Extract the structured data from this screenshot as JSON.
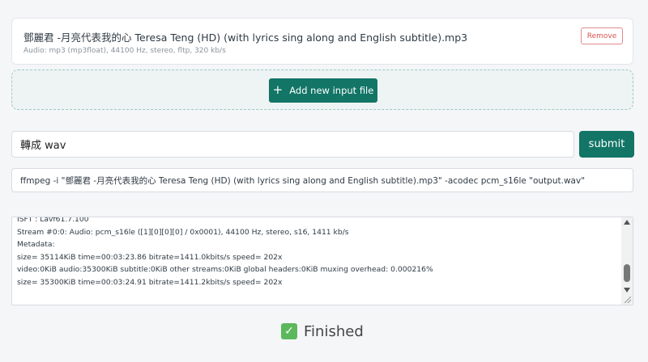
{
  "file": {
    "name": "鄧麗君 -月亮代表我的心 Teresa Teng (HD) (with lyrics sing along and English subtitle).mp3",
    "meta": "Audio: mp3 (mp3float), 44100 Hz, stereo, fltp, 320 kb/s",
    "remove_label": "Remove"
  },
  "dropzone": {
    "add_label": "Add new input file",
    "add_icon": "plus-icon"
  },
  "command": {
    "input_value": "轉成 wav",
    "submit_label": "submit",
    "generated": "ffmpeg -i \"鄧麗君 -月亮代表我的心 Teresa Teng (HD) (with lyrics sing along and English subtitle).mp3\" -acodec pcm_s16le \"output.wav\""
  },
  "log": {
    "lines": [
      "    ISFT           : Lavf61.7.100",
      "Stream #0:0: Audio: pcm_s16le ([1][0][0][0] / 0x0001), 44100 Hz, stereo, s16, 1411 kb/s",
      "Metadata:",
      "size=   35114KiB time=00:03:23.86 bitrate=1411.0kbits/s speed= 202x",
      "video:0KiB audio:35300KiB subtitle:0KiB other streams:0KiB global headers:0KiB muxing overhead: 0.000216%",
      "size=   35300KiB time=00:03:24.91 bitrate=1411.2kbits/s speed= 202x"
    ]
  },
  "status": {
    "text": "Finished",
    "icon": "check-icon"
  },
  "colors": {
    "accent": "#127566",
    "remove": "#d9534f",
    "success": "#5cb85c"
  }
}
